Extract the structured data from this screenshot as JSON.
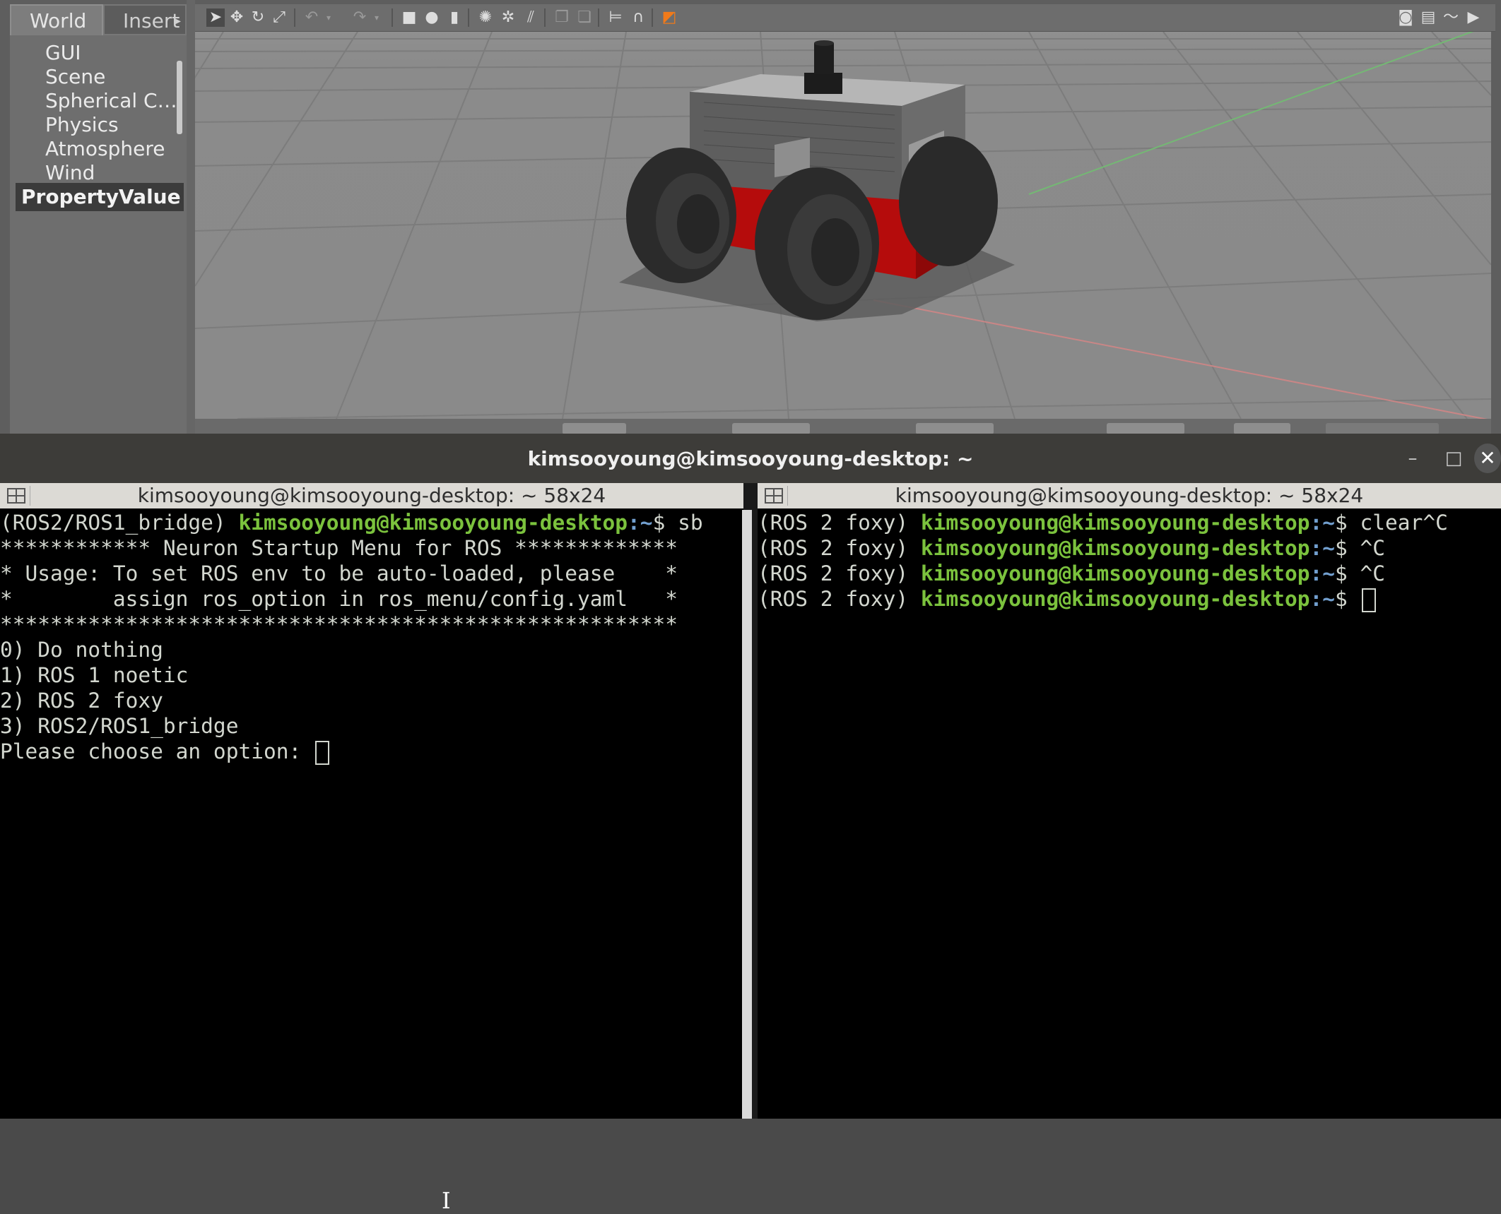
{
  "gazebo": {
    "tabs": {
      "world": "World",
      "insert": "Insert"
    },
    "world_items": [
      "GUI",
      "Scene",
      "Spherical C…",
      "Physics",
      "Atmosphere",
      "Wind"
    ],
    "property_header": "PropertyValue",
    "toolbar_icons": [
      "select-arrow-icon",
      "translate-icon",
      "rotate-icon",
      "scale-icon",
      "undo-icon",
      "redo-icon",
      "box-icon",
      "sphere-icon",
      "cylinder-icon",
      "point-light-icon",
      "spot-light-icon",
      "directional-light-icon",
      "copy-icon",
      "paste-icon",
      "align-icon",
      "snap-icon",
      "view-angle-icon",
      "screenshot-icon",
      "log-icon",
      "plot-icon",
      "video-icon"
    ]
  },
  "terminal": {
    "window_title": "kimsooyoung@kimsooyoung-desktop: ~",
    "left": {
      "header": "kimsooyoung@kimsooyoung-desktop: ~ 58x24",
      "prompt_env": "(ROS2/ROS1_bridge) ",
      "prompt_user": "kimsooyoung@kimsooyoung-desktop",
      "prompt_path": ":~",
      "prompt_cmd": "$ sb",
      "menu_lines": [
        "************ Neuron Startup Menu for ROS *************",
        "* Usage: To set ROS env to be auto-loaded, please    *",
        "*        assign ros_option in ros_menu/config.yaml   *",
        "******************************************************",
        "0) Do nothing",
        "1) ROS 1 noetic",
        "2) ROS 2 foxy",
        "3) ROS2/ROS1_bridge"
      ],
      "input_prompt": "Please choose an option: "
    },
    "right": {
      "header": "kimsooyoung@kimsooyoung-desktop: ~ 58x24",
      "lines": [
        {
          "env": "(ROS 2 foxy) ",
          "user": "kimsooyoung@kimsooyoung-desktop",
          "path": ":~",
          "cmd": "$ clear^C"
        },
        {
          "env": "(ROS 2 foxy) ",
          "user": "kimsooyoung@kimsooyoung-desktop",
          "path": ":~",
          "cmd": "$ ^C"
        },
        {
          "env": "(ROS 2 foxy) ",
          "user": "kimsooyoung@kimsooyoung-desktop",
          "path": ":~",
          "cmd": "$ ^C"
        },
        {
          "env": "(ROS 2 foxy) ",
          "user": "kimsooyoung@kimsooyoung-desktop",
          "path": ":~",
          "cmd": "$ "
        }
      ]
    },
    "window_buttons": {
      "minimize": "–",
      "maximize": "□",
      "close": "✕"
    }
  },
  "colors": {
    "prompt_user": "#7bc23d",
    "prompt_path": "#729fcf",
    "terminal_bg": "#000000",
    "robot_red": "#c01010"
  }
}
